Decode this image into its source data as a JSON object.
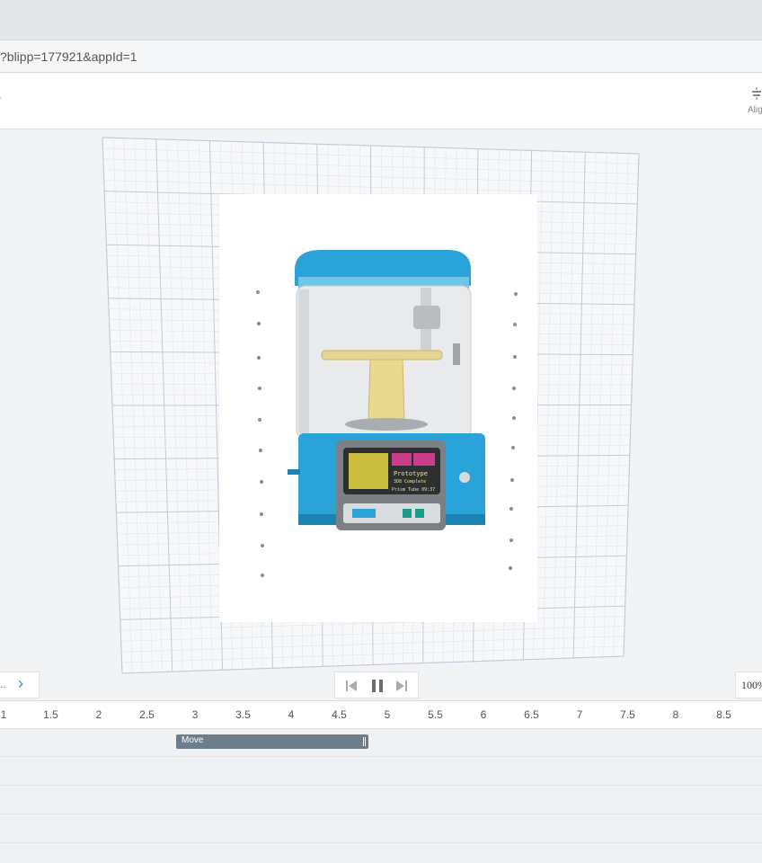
{
  "browser": {
    "address_text": "?blipp=177921&appId=1"
  },
  "toolbar": {
    "align_label": "Alig"
  },
  "canvas": {
    "prev_label": "..",
    "zoom_text": "100%"
  },
  "screen": {
    "printer_title": "Prototype",
    "printer_line2": "3D8 Complete",
    "printer_line3": "Prism Tube  09:37"
  },
  "timeline": {
    "ticks": [
      "1",
      "1.5",
      "2",
      "2.5",
      "3",
      "3.5",
      "4",
      "4.5",
      "5",
      "5.5",
      "6",
      "6.5",
      "7",
      "7.5",
      "8",
      "8.5"
    ],
    "clip_label": "Move"
  },
  "colors": {
    "accent": "#2f8fd6",
    "printer_blue": "#2aa4d8",
    "clip": "#6c7d8c"
  },
  "icons": {
    "align": "align-icon",
    "next": "chevron-right-icon",
    "first": "skip-back-icon",
    "pause": "pause-icon",
    "last": "skip-forward-icon"
  }
}
